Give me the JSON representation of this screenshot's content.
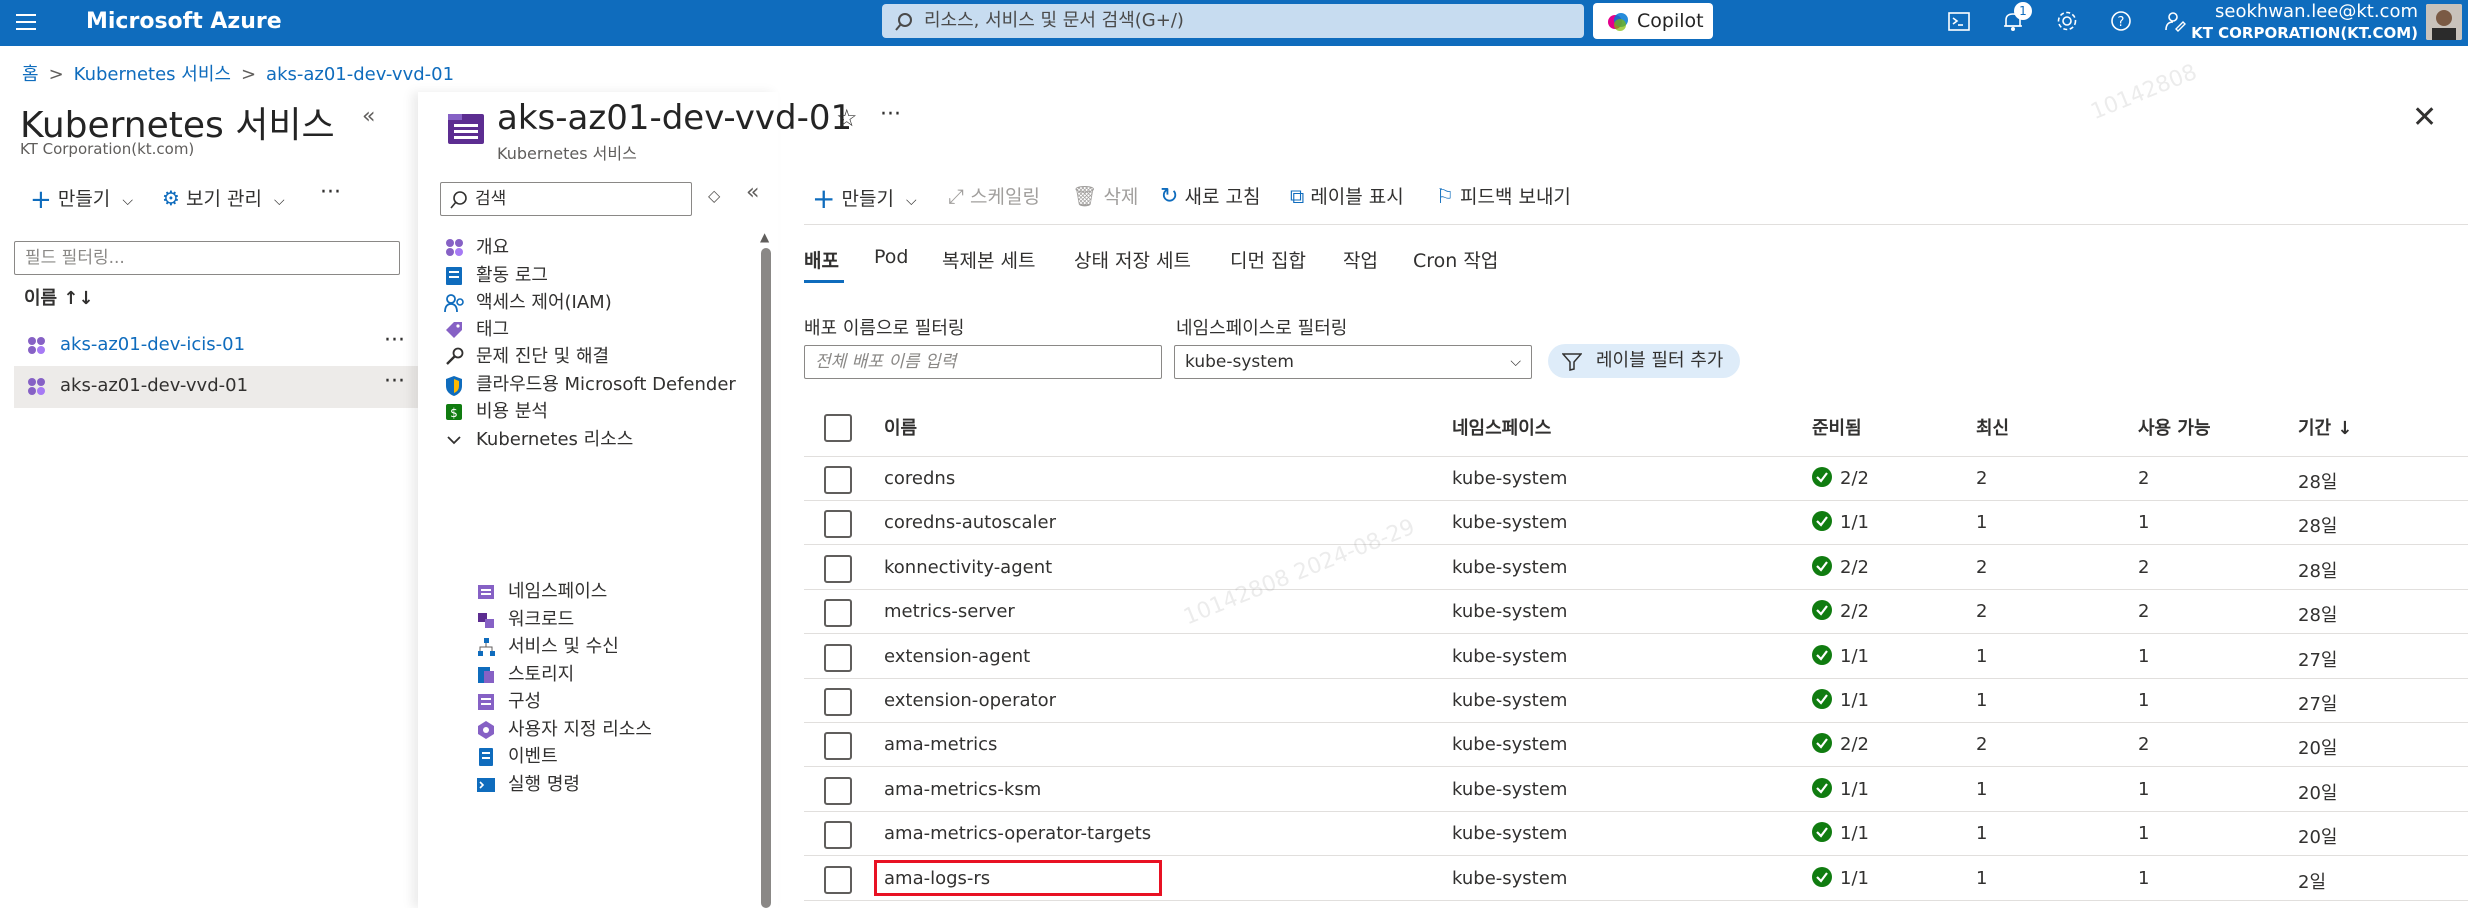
{
  "topbar": {
    "brand": "Microsoft Azure",
    "search_placeholder": "리소스, 서비스 및 문서 검색(G+/)",
    "copilot_label": "Copilot",
    "notification_count": "1",
    "user_name": "seokhwan.lee@kt.com",
    "user_org": "KT CORPORATION(KT.COM)"
  },
  "breadcrumb": [
    "홈",
    "Kubernetes 서비스",
    "aks-az01-dev-vvd-01"
  ],
  "left_pane": {
    "title": "Kubernetes 서비스",
    "subtitle": "KT Corporation(kt.com)",
    "create_label": "만들기",
    "view_label": "보기 관리",
    "filter_placeholder": "필드 필터링...",
    "name_header": "이름 ↑↓",
    "items": [
      {
        "name": "aks-az01-dev-icis-01"
      },
      {
        "name": "aks-az01-dev-vvd-01"
      }
    ]
  },
  "resource": {
    "title": "aks-az01-dev-vvd-01",
    "subtitle": "Kubernetes 서비스"
  },
  "nav": {
    "search_placeholder": "검색",
    "items": [
      {
        "label": "개요",
        "icon": "overview-icon"
      },
      {
        "label": "활동 로그",
        "icon": "activity-log-icon"
      },
      {
        "label": "액세스 제어(IAM)",
        "icon": "iam-icon"
      },
      {
        "label": "태그",
        "icon": "tag-icon"
      },
      {
        "label": "문제 진단 및 해결",
        "icon": "wrench-icon"
      },
      {
        "label": "클라우드용 Microsoft Defender",
        "icon": "shield-icon"
      },
      {
        "label": "비용 분석",
        "icon": "cost-icon"
      },
      {
        "label": "Kubernetes 리소스",
        "icon": "chevron-down-icon"
      }
    ],
    "sub_items": [
      {
        "label": "네임스페이스",
        "icon": "namespace-icon"
      },
      {
        "label": "워크로드",
        "icon": "workload-icon"
      },
      {
        "label": "서비스 및 수신",
        "icon": "service-icon"
      },
      {
        "label": "스토리지",
        "icon": "storage-icon"
      },
      {
        "label": "구성",
        "icon": "config-icon"
      },
      {
        "label": "사용자 지정 리소스",
        "icon": "custom-resource-icon"
      },
      {
        "label": "이벤트",
        "icon": "events-icon"
      },
      {
        "label": "실행 명령",
        "icon": "run-command-icon"
      }
    ]
  },
  "toolbar": {
    "create": "만들기",
    "scale": "스케일링",
    "delete": "삭제",
    "refresh": "새로 고침",
    "labels": "레이블 표시",
    "feedback": "피드백 보내기"
  },
  "tabs": [
    "배포",
    "Pod",
    "복제본 세트",
    "상태 저장 세트",
    "디먼 집합",
    "작업",
    "Cron 작업"
  ],
  "filters": {
    "name_label": "배포 이름으로 필터링",
    "name_placeholder": "전체 배포 이름 입력",
    "ns_label": "네임스페이스로 필터링",
    "ns_value": "kube-system",
    "add_label_filter": "레이블 필터 추가"
  },
  "table": {
    "headers": [
      "이름",
      "네임스페이스",
      "준비됨",
      "최신",
      "사용 가능",
      "기간 ↓"
    ],
    "rows": [
      {
        "name": "coredns",
        "ns": "kube-system",
        "ready": "2/2",
        "latest": "2",
        "avail": "2",
        "age": "28일"
      },
      {
        "name": "coredns-autoscaler",
        "ns": "kube-system",
        "ready": "1/1",
        "latest": "1",
        "avail": "1",
        "age": "28일"
      },
      {
        "name": "konnectivity-agent",
        "ns": "kube-system",
        "ready": "2/2",
        "latest": "2",
        "avail": "2",
        "age": "28일"
      },
      {
        "name": "metrics-server",
        "ns": "kube-system",
        "ready": "2/2",
        "latest": "2",
        "avail": "2",
        "age": "28일"
      },
      {
        "name": "extension-agent",
        "ns": "kube-system",
        "ready": "1/1",
        "latest": "1",
        "avail": "1",
        "age": "27일"
      },
      {
        "name": "extension-operator",
        "ns": "kube-system",
        "ready": "1/1",
        "latest": "1",
        "avail": "1",
        "age": "27일"
      },
      {
        "name": "ama-metrics",
        "ns": "kube-system",
        "ready": "2/2",
        "latest": "2",
        "avail": "2",
        "age": "20일"
      },
      {
        "name": "ama-metrics-ksm",
        "ns": "kube-system",
        "ready": "1/1",
        "latest": "1",
        "avail": "1",
        "age": "20일"
      },
      {
        "name": "ama-metrics-operator-targets",
        "ns": "kube-system",
        "ready": "1/1",
        "latest": "1",
        "avail": "1",
        "age": "20일"
      },
      {
        "name": "ama-logs-rs",
        "ns": "kube-system",
        "ready": "1/1",
        "latest": "1",
        "avail": "1",
        "age": "2일"
      }
    ]
  },
  "watermark": [
    "10142808",
    "10142808 2024-08-29"
  ],
  "colors": {
    "accent": "#0f6cbd",
    "success": "#107c10",
    "highlight": "#e81123"
  }
}
